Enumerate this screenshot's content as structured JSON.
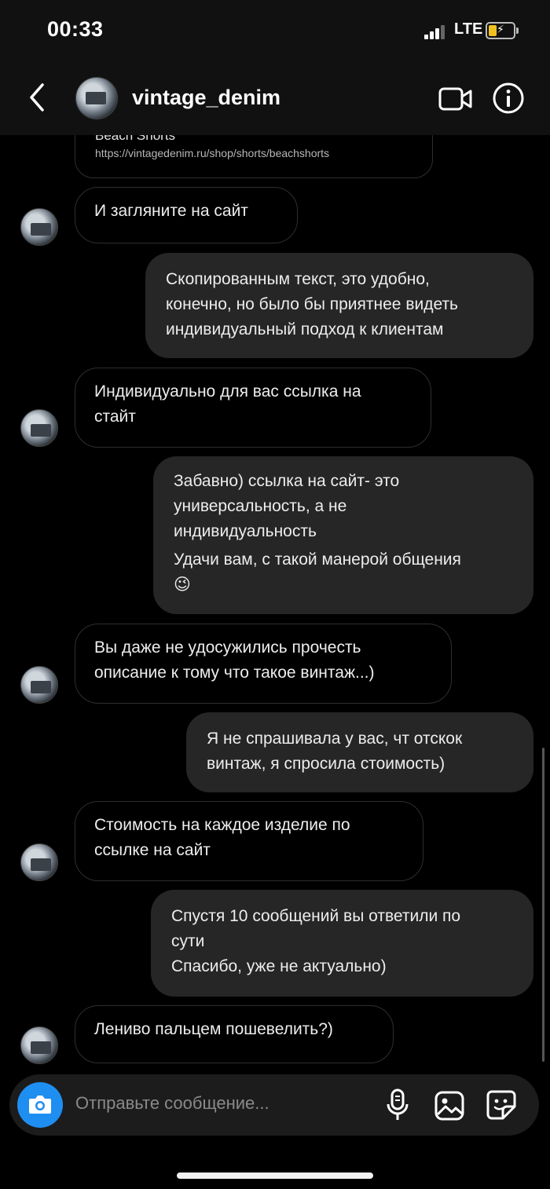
{
  "status_bar": {
    "time": "00:33",
    "network": "LTE"
  },
  "header": {
    "username": "vintage_denim"
  },
  "link_preview": {
    "title": "Beach Shorts",
    "url": "https://vintagedenim.ru/shop/shorts/beachshorts"
  },
  "messages": [
    {
      "lines": [
        "И загляните на сайт"
      ]
    },
    {
      "lines": [
        "Скопированным текст, это удобно,",
        "конечно, но было бы приятнее видеть",
        "индивидуальный подход к клиентам"
      ]
    },
    {
      "lines": [
        "Индивидуально для вас ссылка на",
        "стайт"
      ]
    },
    {
      "lines": [
        "Забавно) ссылка на сайт- это",
        "универсальность, а не",
        "индивидуальность",
        "Удачи вам, с такой манерой общения",
        "😉"
      ]
    },
    {
      "lines": [
        "Вы даже не удосужились прочесть",
        "описание к тому что такое винтаж...)"
      ]
    },
    {
      "lines": [
        "Я не спрашивала у вас, чт отскок",
        "винтаж, я спросила стоимость)"
      ]
    },
    {
      "lines": [
        "Стоимость на каждое изделие по",
        "ссылке на сайт"
      ]
    },
    {
      "lines": [
        "Спустя 10 сообщений вы ответили по",
        "сути",
        "Спасибо, уже не актуально)"
      ]
    },
    {
      "lines": [
        "Лениво пальцем пошевелить?)"
      ]
    }
  ],
  "composer": {
    "placeholder": "Отправьте сообщение..."
  },
  "colors": {
    "camera_button": "#1f8ef1",
    "outgoing_bubble": "#262626",
    "background": "#000000"
  }
}
